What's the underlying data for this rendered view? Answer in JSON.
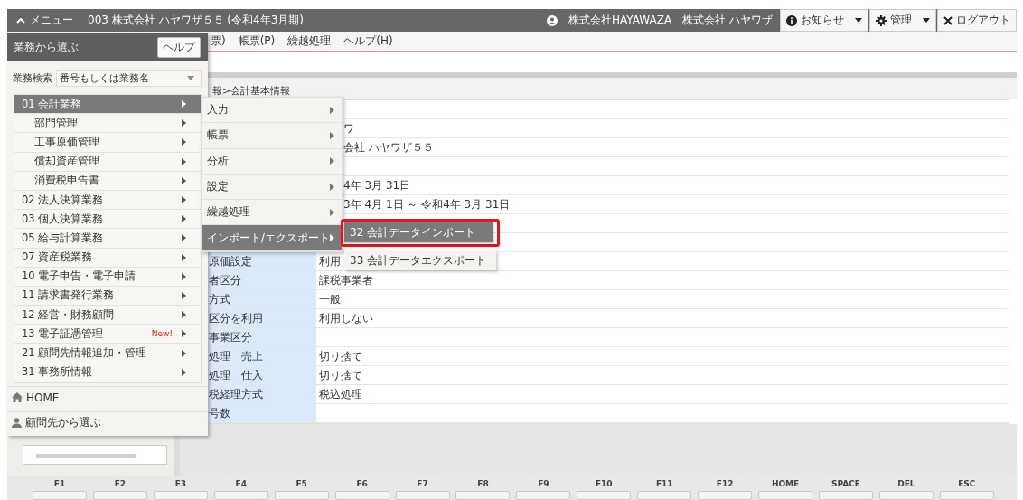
{
  "header": {
    "menu_label": "メニュー",
    "title": "003 株式会社 ハヤワザ５５ (令和4年3月期)",
    "office": "株式会社HAYAWAZA",
    "user": "株式会社 ハヤワザ",
    "buttons": [
      {
        "kind": "info",
        "label": "お知らせ",
        "dropdown": true
      },
      {
        "kind": "gear",
        "label": "管理",
        "dropdown": true
      },
      {
        "kind": "close",
        "label": "ログアウト",
        "dropdown": false
      }
    ]
  },
  "menubar": [
    "票)",
    "帳票(P)",
    "繰越処理",
    "ヘルプ(H)"
  ],
  "breadcrumb": "報>会計基本情報",
  "table": {
    "rows": [
      {
        "value": ""
      },
      {
        "value": "ワ"
      },
      {
        "value": "会社 ハヤワザ５５"
      },
      {
        "value": ""
      },
      {
        "value": "4年 3月 31日"
      },
      {
        "value": "3年 4月 1日 ～ 令和4年 3月 31日"
      },
      {
        "value": ""
      },
      {
        "value": ""
      },
      {
        "label": "原価設定",
        "value": "利用"
      },
      {
        "label": "者区分",
        "value": "課税事業者"
      },
      {
        "label": "方式",
        "value": "一般"
      },
      {
        "label": "区分を利用",
        "value": "利用しない"
      },
      {
        "label": "事業区分",
        "value": ""
      },
      {
        "label": "処理　売上",
        "value": "切り捨て"
      },
      {
        "label": "処理　仕入",
        "value": "切り捨て"
      },
      {
        "label": "税経理方式",
        "value": "税込処理"
      },
      {
        "label": "号数",
        "value": ""
      }
    ]
  },
  "menu_panel": {
    "title": "業務から選ぶ",
    "help_button": "ヘルプ",
    "search": {
      "label": "業務検索",
      "value": "番号もしくは業務名"
    },
    "items": [
      {
        "label": "01 会計業務",
        "selected": true,
        "children": [
          {
            "label": "部門管理",
            "selected": false
          },
          {
            "label": "工事原価管理",
            "selected": false
          },
          {
            "label": "償却資産管理",
            "selected": false
          },
          {
            "label": "消費税申告書",
            "selected": false
          }
        ]
      },
      {
        "label": "02 法人決算業務",
        "selected": false
      },
      {
        "label": "03 個人決算業務",
        "selected": false
      },
      {
        "label": "05 給与計算業務",
        "selected": false
      },
      {
        "label": "07 資産税業務",
        "selected": false
      },
      {
        "label": "10 電子申告・電子申請",
        "selected": false
      },
      {
        "label": "11 請求書発行業務",
        "selected": false
      },
      {
        "label": "12 経営・財務顧問",
        "selected": false
      },
      {
        "label": "13 電子証憑管理",
        "selected": false,
        "badge": "New!"
      },
      {
        "label": "21 顧問先情報追加・管理",
        "selected": false
      },
      {
        "label": "31 事務所情報",
        "selected": false
      }
    ],
    "links": [
      {
        "kind": "home",
        "label": "HOME"
      },
      {
        "kind": "person",
        "label": "顧問先から選ぶ"
      }
    ]
  },
  "submenu": [
    {
      "label": "入力",
      "selected": false
    },
    {
      "label": "帳票",
      "selected": false
    },
    {
      "label": "分析",
      "selected": false
    },
    {
      "label": "設定",
      "selected": false
    },
    {
      "label": "繰越処理",
      "selected": false
    },
    {
      "label": "インポート/エクスポート",
      "selected": true
    }
  ],
  "submenu_2": [
    {
      "label": "32 会計データインポート",
      "selected": true,
      "highlighted": true
    },
    {
      "label": "33 会計データエクスポート",
      "selected": false,
      "highlighted": false
    }
  ],
  "function_keys": [
    "F1",
    "F2",
    "F3",
    "F4",
    "F5",
    "F6",
    "F7",
    "F8",
    "F9",
    "F10",
    "F11",
    "F12",
    "HOME",
    "SPACE",
    "DEL",
    "ESC"
  ]
}
